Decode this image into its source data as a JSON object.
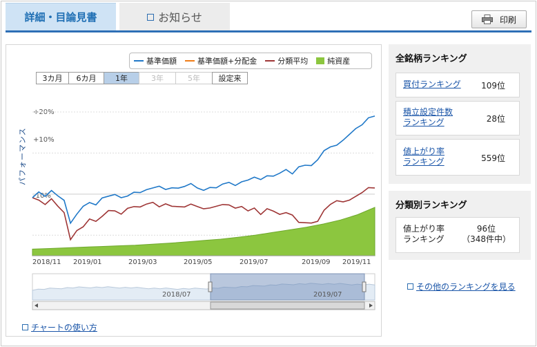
{
  "tabs": [
    {
      "label": "詳細・目論見書",
      "active": true
    },
    {
      "label": "お知らせ",
      "active": false
    }
  ],
  "toolbar": {
    "print_label": "印刷"
  },
  "legend": [
    {
      "label": "基準価額",
      "color": "#1f78c8"
    },
    {
      "label": "基準価額+分配金",
      "color": "#f07c16"
    },
    {
      "label": "分類平均",
      "color": "#9e3535"
    },
    {
      "label": "純資産",
      "color": "#8cc63f"
    }
  ],
  "range_buttons": [
    "3カ月",
    "6カ月",
    "1年",
    "3年",
    "5年",
    "設定来"
  ],
  "chart_data": {
    "type": "line",
    "ylabel": "パフォーマンス",
    "y_ticks": [
      "+20%",
      "+10%",
      "-10%"
    ],
    "x_ticks": [
      "2018/11",
      "2019/01",
      "2019/03",
      "2019/05",
      "2019/07",
      "2019/09",
      "2019/11"
    ],
    "navigator_ticks": [
      "2018/07",
      "2019/07"
    ],
    "ylim": [
      -15,
      21
    ],
    "series": [
      {
        "name": "基準価額",
        "color": "#1f78c8",
        "values": [
          -1,
          0.5,
          -0.5,
          1,
          -0.5,
          -1.5,
          -7,
          -5,
          -3,
          -2,
          -2.5,
          -1,
          -0.5,
          0,
          -1,
          -0.5,
          0.5,
          0.5,
          1,
          1.5,
          2,
          1,
          1.5,
          1.5,
          2,
          2.5,
          1.5,
          1,
          1.5,
          1.5,
          2.5,
          3,
          2,
          3,
          3.5,
          4,
          3.5,
          4.5,
          4.5,
          5,
          6,
          5,
          6.5,
          7,
          7,
          8.5,
          10.5,
          11.5,
          12,
          13,
          14.5,
          16,
          17,
          18.5,
          19
        ]
      },
      {
        "name": "分類平均",
        "color": "#9e3535",
        "values": [
          -1,
          -1.5,
          -2.5,
          -1,
          -3,
          -4.5,
          -11,
          -9,
          -8,
          -6,
          -6.5,
          -5.5,
          -4,
          -4,
          -5,
          -3.5,
          -3,
          -3,
          -2.5,
          -2,
          -3,
          -2.5,
          -3,
          -3,
          -3,
          -2.5,
          -3,
          -3.5,
          -3.5,
          -3,
          -2.5,
          -2.5,
          -3.5,
          -3,
          -4,
          -3.5,
          -5,
          -3.5,
          -4,
          -5,
          -4.5,
          -5,
          -7,
          -7,
          -7,
          -6.5,
          -4,
          -2.5,
          -1.5,
          -2,
          -1.5,
          -0.5,
          0.5,
          1.5,
          1.5
        ]
      },
      {
        "name": "純資産",
        "color": "#8cc63f",
        "values": [
          1,
          1.1,
          1.2,
          1.3,
          1.4,
          1.5,
          1.6,
          1.75,
          1.9,
          2.1,
          2.3,
          2.5,
          2.8,
          3.1,
          3.5,
          3.9,
          4.3,
          4.8,
          5.4,
          6.2,
          7.3
        ]
      }
    ]
  },
  "chart_help_label": "チャートの使い方",
  "all_rank": {
    "title": "全銘柄ランキング",
    "items": [
      {
        "label": "買付ランキング",
        "value": "109位"
      },
      {
        "label": "積立設定件数ランキング",
        "label_lines": [
          "積立設定件数",
          "ランキング"
        ],
        "value": "28位"
      },
      {
        "label": "値上がり率ランキング",
        "label_lines": [
          "値上がり率",
          "ランキング"
        ],
        "value": "559位"
      }
    ]
  },
  "class_rank": {
    "title": "分類別ランキング",
    "item": {
      "label_lines": [
        "値上がり率",
        "ランキング"
      ],
      "value": "96位",
      "sub": "（348件中）"
    }
  },
  "more_rank_label": "その他のランキングを見る"
}
